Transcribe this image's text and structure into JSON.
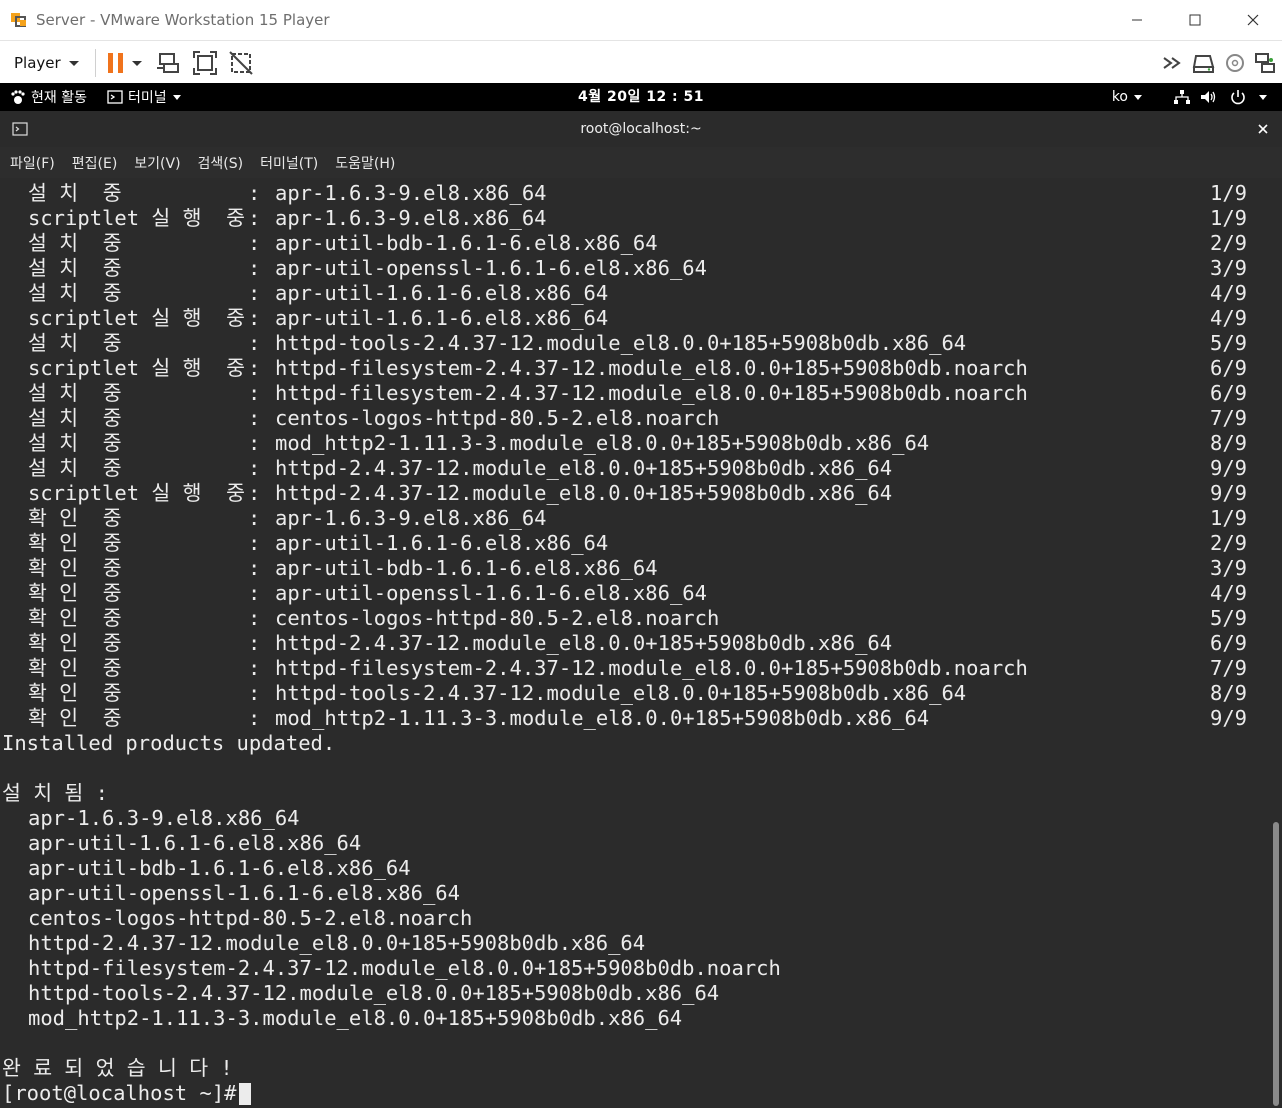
{
  "window": {
    "title": "Server - VMware Workstation 15 Player"
  },
  "toolbar": {
    "player_label": "Player"
  },
  "gnome_bar": {
    "activities": "현재 활동",
    "terminal_menu": "터미널",
    "clock": "4월 20일  12 : 51",
    "lang": "ko"
  },
  "terminal": {
    "title": "root@localhost:~",
    "menu": [
      "파일(F)",
      "편집(E)",
      "보기(V)",
      "검색(S)",
      "터미널(T)",
      "도움말(H)"
    ],
    "transaction_rows": [
      {
        "action": "설 치  중",
        "pkg": "apr-1.6.3-9.el8.x86_64",
        "count": "1/9"
      },
      {
        "action": "scriptlet 실 행  중",
        "pkg": "apr-1.6.3-9.el8.x86_64",
        "count": "1/9"
      },
      {
        "action": "설 치  중",
        "pkg": "apr-util-bdb-1.6.1-6.el8.x86_64",
        "count": "2/9"
      },
      {
        "action": "설 치  중",
        "pkg": "apr-util-openssl-1.6.1-6.el8.x86_64",
        "count": "3/9"
      },
      {
        "action": "설 치  중",
        "pkg": "apr-util-1.6.1-6.el8.x86_64",
        "count": "4/9"
      },
      {
        "action": "scriptlet 실 행  중",
        "pkg": "apr-util-1.6.1-6.el8.x86_64",
        "count": "4/9"
      },
      {
        "action": "설 치  중",
        "pkg": "httpd-tools-2.4.37-12.module_el8.0.0+185+5908b0db.x86_64",
        "count": "5/9"
      },
      {
        "action": "scriptlet 실 행  중",
        "pkg": "httpd-filesystem-2.4.37-12.module_el8.0.0+185+5908b0db.noarch",
        "count": "6/9"
      },
      {
        "action": "설 치  중",
        "pkg": "httpd-filesystem-2.4.37-12.module_el8.0.0+185+5908b0db.noarch",
        "count": "6/9"
      },
      {
        "action": "설 치  중",
        "pkg": "centos-logos-httpd-80.5-2.el8.noarch",
        "count": "7/9"
      },
      {
        "action": "설 치  중",
        "pkg": "mod_http2-1.11.3-3.module_el8.0.0+185+5908b0db.x86_64",
        "count": "8/9"
      },
      {
        "action": "설 치  중",
        "pkg": "httpd-2.4.37-12.module_el8.0.0+185+5908b0db.x86_64",
        "count": "9/9"
      },
      {
        "action": "scriptlet 실 행  중",
        "pkg": "httpd-2.4.37-12.module_el8.0.0+185+5908b0db.x86_64",
        "count": "9/9"
      },
      {
        "action": "확 인  중",
        "pkg": "apr-1.6.3-9.el8.x86_64",
        "count": "1/9"
      },
      {
        "action": "확 인  중",
        "pkg": "apr-util-1.6.1-6.el8.x86_64",
        "count": "2/9"
      },
      {
        "action": "확 인  중",
        "pkg": "apr-util-bdb-1.6.1-6.el8.x86_64",
        "count": "3/9"
      },
      {
        "action": "확 인  중",
        "pkg": "apr-util-openssl-1.6.1-6.el8.x86_64",
        "count": "4/9"
      },
      {
        "action": "확 인  중",
        "pkg": "centos-logos-httpd-80.5-2.el8.noarch",
        "count": "5/9"
      },
      {
        "action": "확 인  중",
        "pkg": "httpd-2.4.37-12.module_el8.0.0+185+5908b0db.x86_64",
        "count": "6/9"
      },
      {
        "action": "확 인  중",
        "pkg": "httpd-filesystem-2.4.37-12.module_el8.0.0+185+5908b0db.noarch",
        "count": "7/9"
      },
      {
        "action": "확 인  중",
        "pkg": "httpd-tools-2.4.37-12.module_el8.0.0+185+5908b0db.x86_64",
        "count": "8/9"
      },
      {
        "action": "확 인  중",
        "pkg": "mod_http2-1.11.3-3.module_el8.0.0+185+5908b0db.x86_64",
        "count": "9/9"
      }
    ],
    "colon": ":",
    "products_updated": "Installed products updated.",
    "installed_header": "설 치 됨 :",
    "installed_list": [
      "apr-1.6.3-9.el8.x86_64",
      "apr-util-1.6.1-6.el8.x86_64",
      "apr-util-bdb-1.6.1-6.el8.x86_64",
      "apr-util-openssl-1.6.1-6.el8.x86_64",
      "centos-logos-httpd-80.5-2.el8.noarch",
      "httpd-2.4.37-12.module_el8.0.0+185+5908b0db.x86_64",
      "httpd-filesystem-2.4.37-12.module_el8.0.0+185+5908b0db.noarch",
      "httpd-tools-2.4.37-12.module_el8.0.0+185+5908b0db.x86_64",
      "mod_http2-1.11.3-3.module_el8.0.0+185+5908b0db.x86_64"
    ],
    "complete": "완 료 되 었 습 니 다 !",
    "prompt": "[root@localhost ~]#"
  },
  "colors": {
    "terminal_bg": "#2b2b2b",
    "terminal_fg": "#ececec",
    "gnome_bar_bg": "#000000",
    "pause_orange": "#f0731c"
  }
}
